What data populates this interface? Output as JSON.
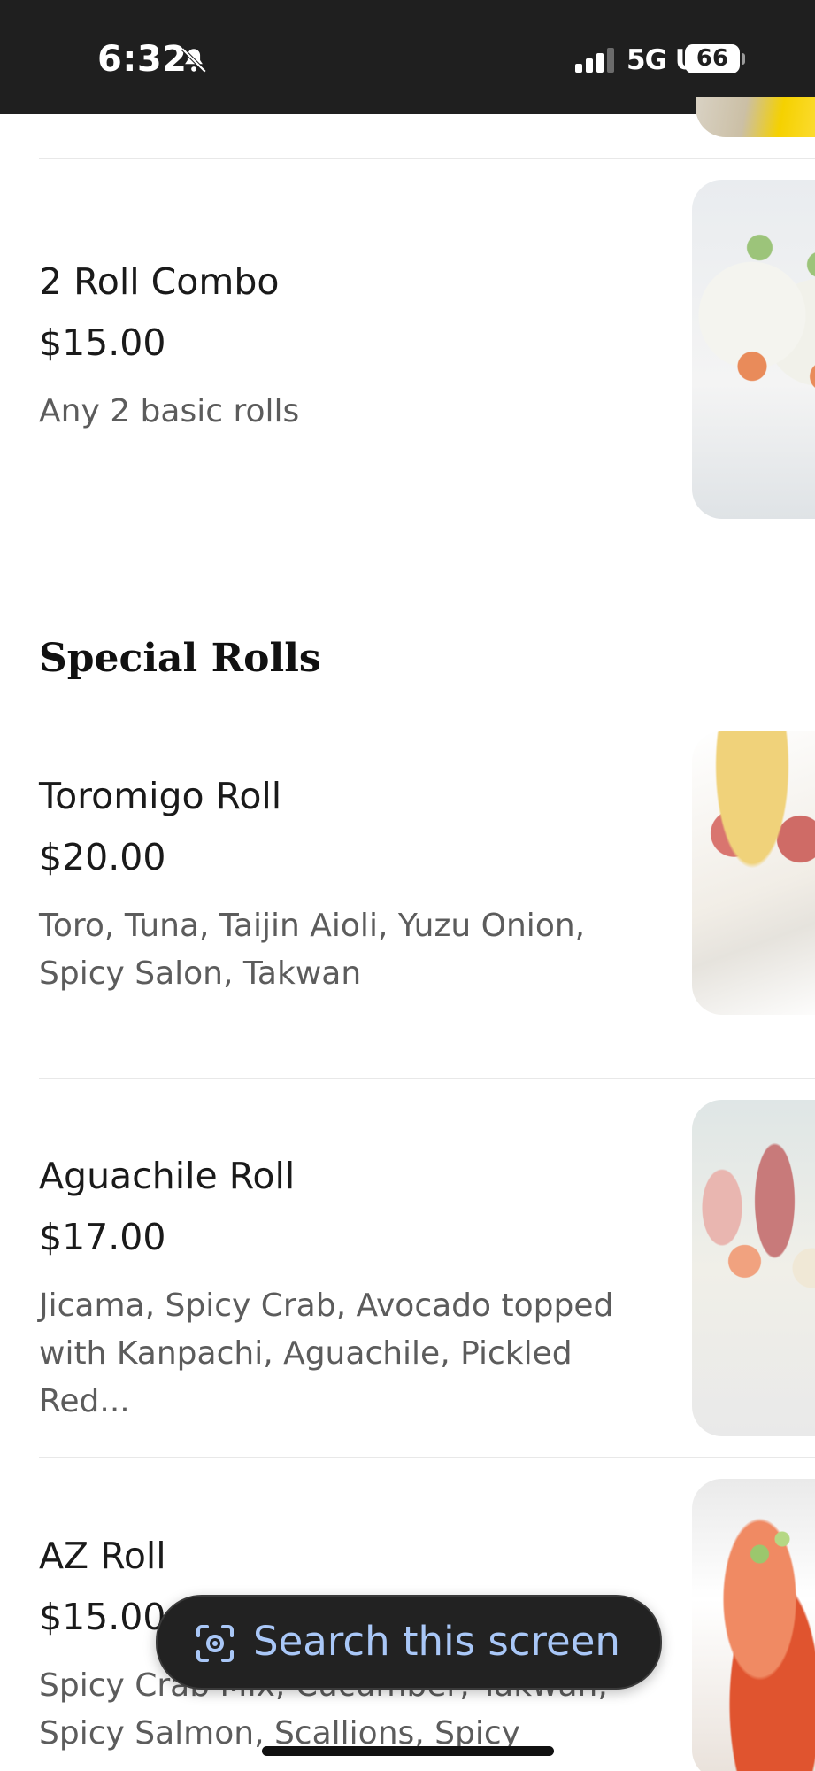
{
  "status_bar": {
    "time": "6:32",
    "network": "5G UW",
    "battery": "66",
    "icons": [
      "bell-slash-icon",
      "signal-bars-icon"
    ]
  },
  "menu": {
    "items_top": [
      {
        "name": "2 Roll Combo",
        "price": "$15.00",
        "description": "Any 2 basic rolls"
      }
    ],
    "section": {
      "title": "Special Rolls",
      "items": [
        {
          "name": "Toromigo Roll",
          "price": "$20.00",
          "description_lines": [
            "Toro, Tuna, Taijin Aioli, Yuzu Onion,",
            "Spicy Salon, Takwan"
          ]
        },
        {
          "name": "Aguachile Roll",
          "price": "$17.00",
          "description_lines": [
            "Jicama, Spicy Crab, Avocado topped",
            "with Kanpachi, Aguachile, Pickled Red..."
          ]
        },
        {
          "name": "AZ Roll",
          "price": "$15.00",
          "description_lines": [
            "Spicy Crab Mix, Cucumber, Takwan,",
            "Spicy Salmon, Scallions, Spicy"
          ]
        }
      ]
    }
  },
  "overlay": {
    "search_label": "Search this screen",
    "icon": "google-lens-icon",
    "accent_color": "#a9c7f7"
  }
}
